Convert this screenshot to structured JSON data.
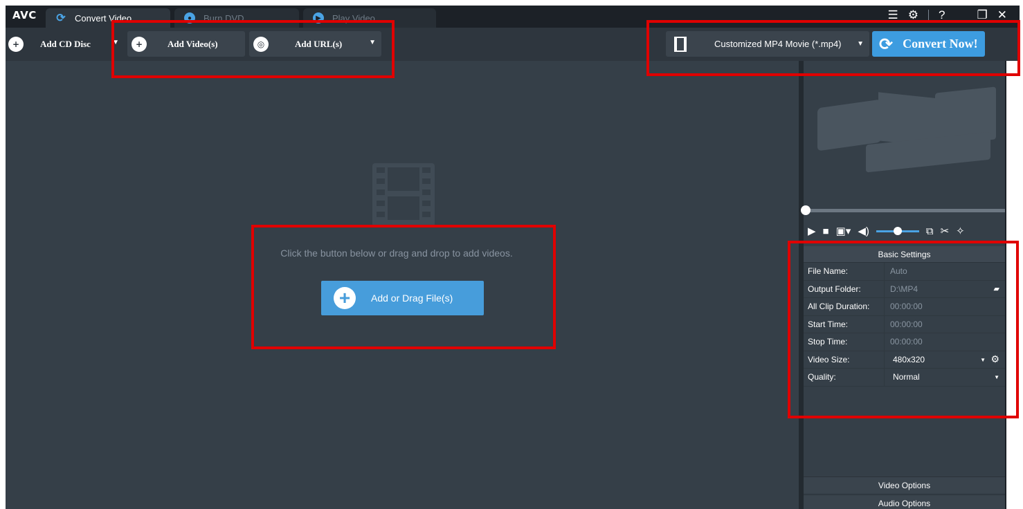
{
  "app": {
    "logo": "AVC",
    "tabs": [
      {
        "label": "Convert Video",
        "icon": "refresh-icon",
        "active": true
      },
      {
        "label": "Burn DVD",
        "icon": "disc-icon",
        "active": false
      },
      {
        "label": "Play Video",
        "icon": "play-icon",
        "active": false
      }
    ],
    "window_controls": {
      "menu": "☰",
      "settings": "⚙",
      "help": "?",
      "restore": "❐",
      "close": "✕"
    }
  },
  "toolbar": {
    "add_cd_disc": "Add CD Disc",
    "add_videos": "Add Video(s)",
    "add_urls": "Add URL(s)",
    "profile": "Customized MP4 Movie (*.mp4)",
    "convert_now": "Convert Now!"
  },
  "main": {
    "hint": "Click the button below or drag and drop to add videos.",
    "add_button": "Add or Drag File(s)"
  },
  "basic_settings": {
    "header": "Basic Settings",
    "rows": [
      {
        "label": "File Name:",
        "value": "Auto"
      },
      {
        "label": "Output Folder:",
        "value": "D:\\MP4"
      },
      {
        "label": "All Clip Duration:",
        "value": "00:00:00"
      },
      {
        "label": "Start Time:",
        "value": "00:00:00"
      },
      {
        "label": "Stop Time:",
        "value": "00:00:00"
      },
      {
        "label": "Video Size:",
        "value": "480x320"
      },
      {
        "label": "Quality:",
        "value": "Normal"
      }
    ]
  },
  "panels": {
    "video_options": "Video Options",
    "audio_options": "Audio Options"
  },
  "colors": {
    "accent": "#3d9ce0",
    "panel_bg": "#353f48",
    "toolbar_bg": "#2e363e",
    "annotation": "#e00000"
  },
  "player": {
    "volume_level": 0.5,
    "seek_position": 0.0
  }
}
